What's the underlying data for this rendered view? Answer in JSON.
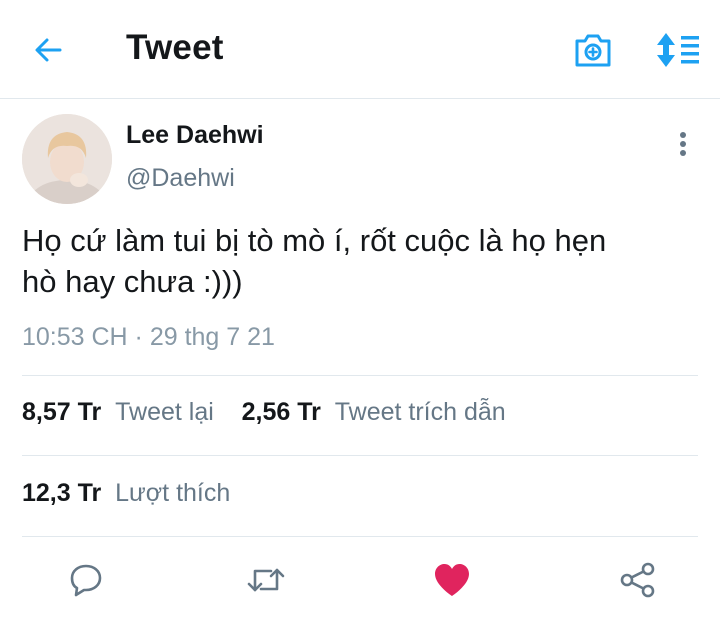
{
  "header": {
    "title": "Tweet",
    "back_icon": "arrow-left-icon",
    "camera_icon": "camera-icon",
    "sort_icon": "sort-icon"
  },
  "tweet": {
    "author": {
      "display_name": "Lee Daehwi",
      "handle": "@Daehwi"
    },
    "text_line1": "Họ cứ làm tui bị tò mò í, rốt cuộc là họ hẹn",
    "text_line2": "hò hay chưa :)))",
    "timestamp": "10:53 CH · 29 thg 7 21",
    "stats": {
      "retweets_count": "8,57 Tr",
      "retweets_label": "Tweet lại",
      "quotes_count": "2,56 Tr",
      "quotes_label": "Tweet trích dẫn",
      "likes_count": "12,3 Tr",
      "likes_label": "Lượt thích"
    },
    "liked": true
  },
  "colors": {
    "accent": "#1da1f2",
    "like": "#e0245e",
    "secondary_text": "#657786",
    "divider": "#e1e8ed"
  }
}
